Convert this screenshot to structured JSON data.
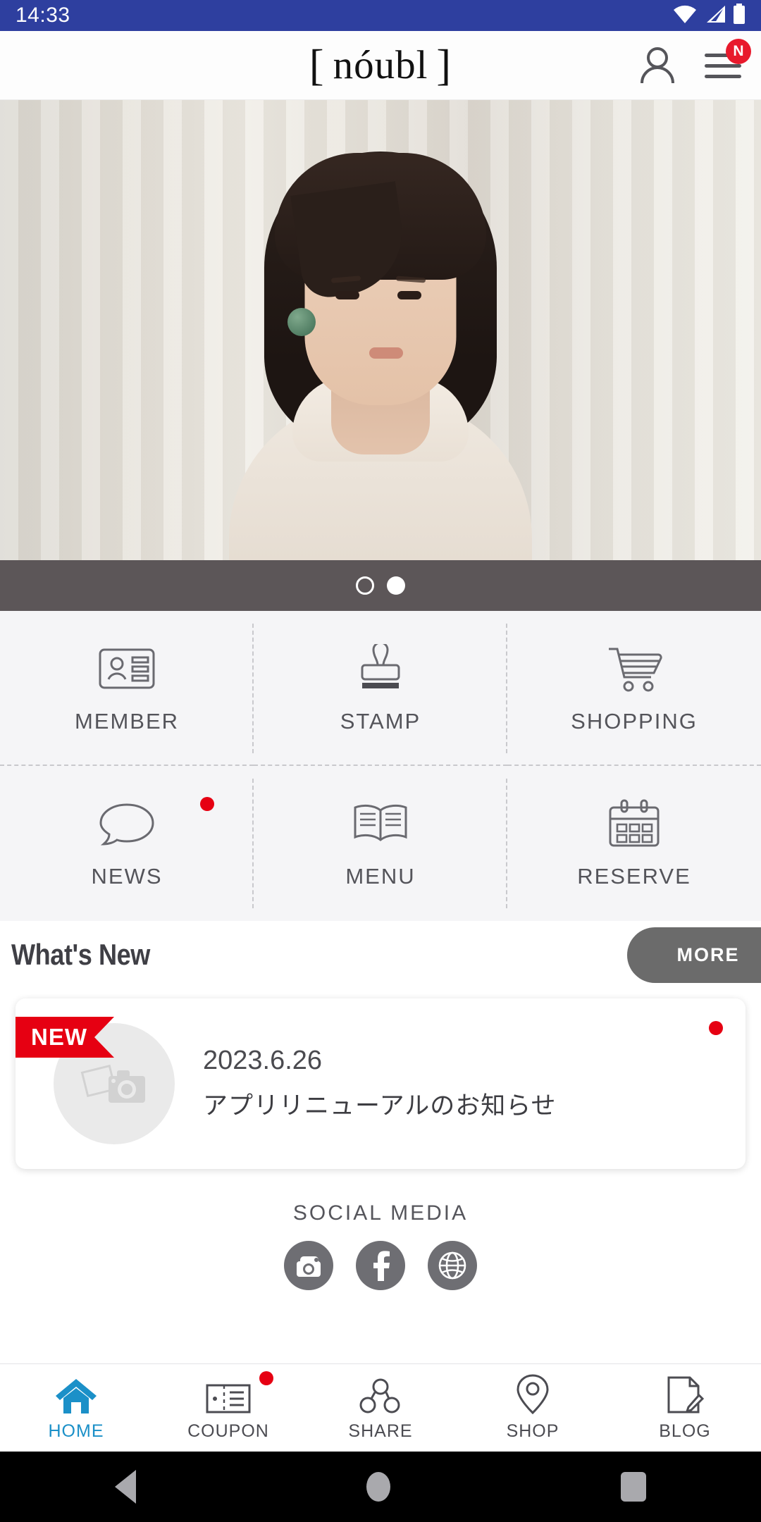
{
  "status_bar": {
    "time": "14:33",
    "background": "#2e3f9f",
    "icons": [
      "wifi-icon",
      "signal-icon",
      "battery-icon"
    ]
  },
  "header": {
    "logo": "nóubl",
    "bracket_left": "[",
    "bracket_right": "]",
    "account_icon": "person-icon",
    "menu_icon": "hamburger-menu-icon",
    "menu_badge": "N",
    "badge_color": "#e8192c"
  },
  "hero": {
    "alt": "portrait-banner",
    "carousel": {
      "total": 2,
      "active_index": 1
    }
  },
  "grid": {
    "items": [
      {
        "label": "MEMBER",
        "icon": "id-card-icon",
        "badge": false
      },
      {
        "label": "STAMP",
        "icon": "rubber-stamp-icon",
        "badge": false
      },
      {
        "label": "SHOPPING",
        "icon": "shopping-cart-icon",
        "badge": false
      },
      {
        "label": "NEWS",
        "icon": "speech-bubble-icon",
        "badge": true
      },
      {
        "label": "MENU",
        "icon": "open-book-icon",
        "badge": false
      },
      {
        "label": "RESERVE",
        "icon": "calendar-icon",
        "badge": false
      }
    ],
    "badge_color": "#e60012"
  },
  "whats_new": {
    "title": "What's New",
    "more_label": "MORE",
    "more_bg": "#6b6b6b",
    "items": [
      {
        "ribbon": "NEW",
        "ribbon_color": "#e60012",
        "date": "2023.6.26",
        "title": "アプリリニューアルのお知らせ",
        "thumbnail_icon": "photo-camera-placeholder-icon",
        "unread": true
      }
    ]
  },
  "social_media": {
    "title": "SOCIAL MEDIA",
    "icon_bg": "#6e6e73",
    "items": [
      {
        "name": "instagram-icon"
      },
      {
        "name": "facebook-icon"
      },
      {
        "name": "website-globe-icon"
      }
    ]
  },
  "bottom_nav": {
    "active_color": "#1b90c8",
    "items": [
      {
        "label": "HOME",
        "icon": "home-icon",
        "active": true,
        "badge": false
      },
      {
        "label": "COUPON",
        "icon": "ticket-icon",
        "active": false,
        "badge": true
      },
      {
        "label": "SHARE",
        "icon": "share-nodes-icon",
        "active": false,
        "badge": false
      },
      {
        "label": "SHOP",
        "icon": "map-pin-icon",
        "active": false,
        "badge": false
      },
      {
        "label": "BLOG",
        "icon": "document-pen-icon",
        "active": false,
        "badge": false
      }
    ]
  },
  "android_nav": {
    "back": "back-triangle-icon",
    "home": "home-circle-icon",
    "recents": "recents-square-icon"
  }
}
